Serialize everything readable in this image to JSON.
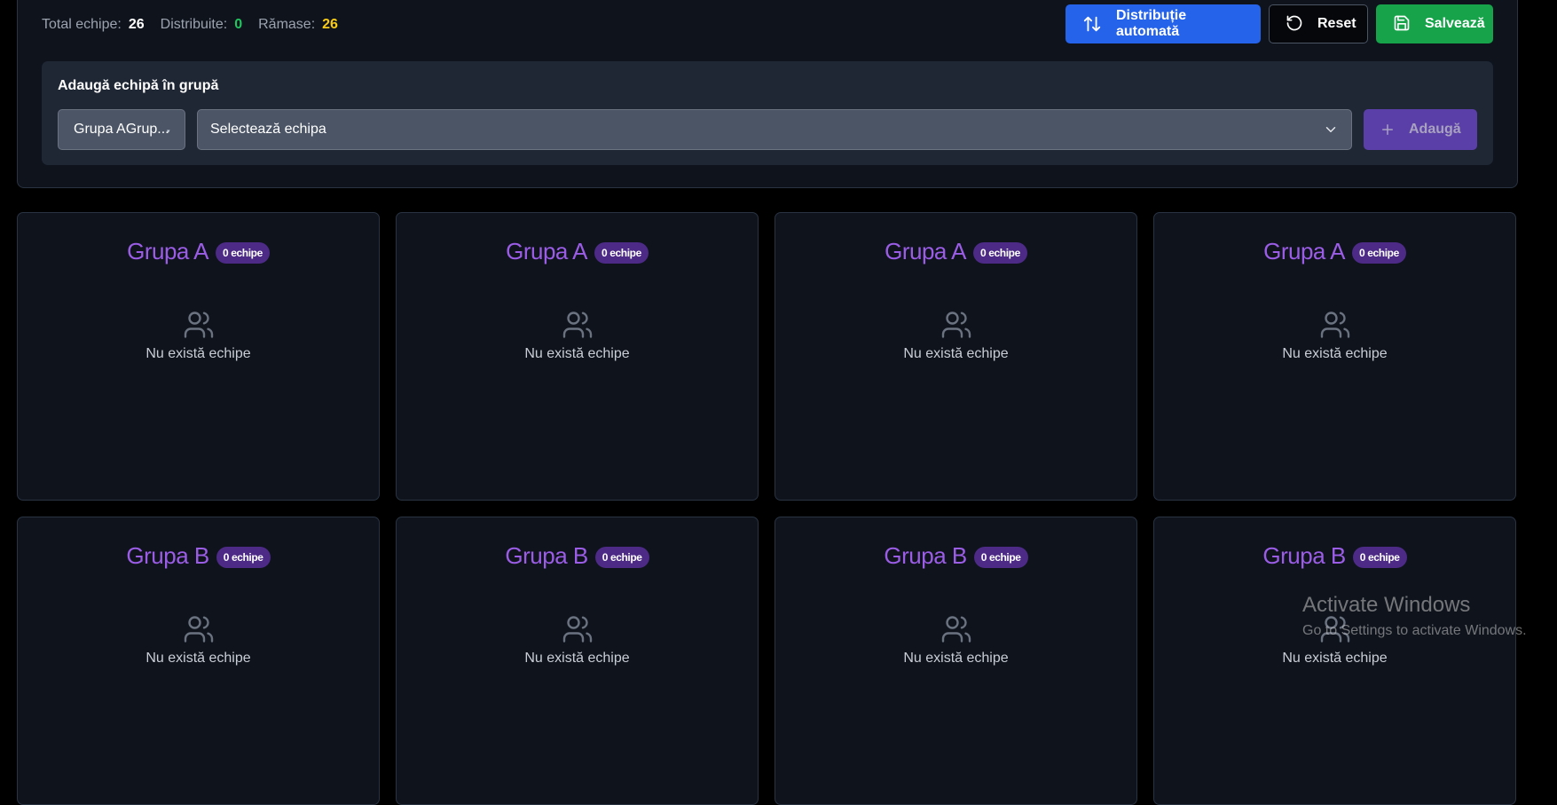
{
  "stats": {
    "total_label": "Total echipe:",
    "total_value": "26",
    "distributed_label": "Distribuite:",
    "distributed_value": "0",
    "remaining_label": "Rămase:",
    "remaining_value": "26"
  },
  "actions": {
    "auto_label": "Distribuție automată",
    "reset_label": "Reset",
    "save_label": "Salvează"
  },
  "add_panel": {
    "title": "Adaugă echipă în grupă",
    "group_select_value": "Grupa AGrup...",
    "team_select_value": "Selectează echipa",
    "add_label": "Adaugă"
  },
  "colors": {
    "accent_purple": "#9b5de5",
    "badge_bg": "#4c2a86",
    "primary_blue": "#2563eb",
    "success_green": "#16a34a",
    "distributed_green": "#22c55e",
    "remaining_yellow": "#facc15"
  },
  "groups": [
    {
      "name": "Grupa A",
      "badge": "0 echipe",
      "empty": "Nu există echipe"
    },
    {
      "name": "Grupa A",
      "badge": "0 echipe",
      "empty": "Nu există echipe"
    },
    {
      "name": "Grupa A",
      "badge": "0 echipe",
      "empty": "Nu există echipe"
    },
    {
      "name": "Grupa A",
      "badge": "0 echipe",
      "empty": "Nu există echipe"
    },
    {
      "name": "Grupa B",
      "badge": "0 echipe",
      "empty": "Nu există echipe"
    },
    {
      "name": "Grupa B",
      "badge": "0 echipe",
      "empty": "Nu există echipe"
    },
    {
      "name": "Grupa B",
      "badge": "0 echipe",
      "empty": "Nu există echipe"
    },
    {
      "name": "Grupa B",
      "badge": "0 echipe",
      "empty": "Nu există echipe"
    }
  ],
  "watermark": {
    "title": "Activate Windows",
    "subtitle": "Go to Settings to activate Windows."
  }
}
